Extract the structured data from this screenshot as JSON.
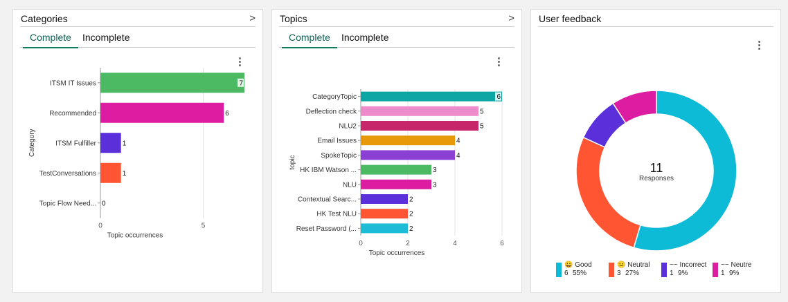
{
  "categories_card": {
    "title": "Categories",
    "nav_glyph": ">",
    "tabs": [
      "Complete",
      "Incomplete"
    ],
    "menu_glyph": "⋮",
    "chart_data": {
      "type": "bar",
      "orientation": "horizontal",
      "categories": [
        "ITSM IT Issues",
        "Recommended",
        "ITSM Fulfiller",
        "TestConversations",
        "Topic Flow Need..."
      ],
      "values": [
        7,
        6,
        1,
        1,
        0
      ],
      "colors": [
        "#4cba63",
        "#dd1da1",
        "#5b2fd9",
        "#ff5533",
        "#888888"
      ],
      "xlabel": "Topic occurrences",
      "ylabel": "Category",
      "xticks": [
        0,
        5
      ],
      "xlim": [
        0,
        7
      ],
      "grid": true
    }
  },
  "topics_card": {
    "title": "Topics",
    "nav_glyph": ">",
    "tabs": [
      "Complete",
      "Incomplete"
    ],
    "menu_glyph": "⋮",
    "chart_data": {
      "type": "bar",
      "orientation": "horizontal",
      "categories": [
        "CategoryTopic",
        "Deflection check",
        "NLU2",
        "Email Issues",
        "SpokeTopic",
        "HK IBM Watson ...",
        "NLU",
        "Contextual Searc...",
        "HK Test NLU",
        "Reset Password (..."
      ],
      "values": [
        6,
        5,
        5,
        4,
        4,
        3,
        3,
        2,
        2,
        2
      ],
      "colors": [
        "#0ea5a5",
        "#ee8ccb",
        "#c7276a",
        "#e7990a",
        "#8b3fd4",
        "#4cba63",
        "#dd1da1",
        "#5b2fd9",
        "#ff5533",
        "#1cbcd6"
      ],
      "xlabel": "Topic occurrences",
      "ylabel": "topic",
      "xticks": [
        0,
        2,
        4,
        6
      ],
      "xlim": [
        0,
        6
      ],
      "grid": true
    }
  },
  "feedback_card": {
    "title": "User feedback",
    "menu_glyph": "⋮",
    "center_value": "11",
    "center_label": "Responses",
    "chart_data": {
      "type": "pie",
      "donut": true,
      "categories": [
        "Good",
        "Neutral",
        "Incorrect",
        "Neutre"
      ],
      "values": [
        6,
        3,
        1,
        1
      ],
      "percent_labels": [
        "55%",
        "27%",
        "9%",
        "9%"
      ],
      "colors": [
        "#0ebbd6",
        "#ff5533",
        "#5b2fd9",
        "#dd1da1"
      ]
    },
    "legend": [
      {
        "prefix": "😀",
        "name": "Good",
        "count": "6",
        "pct": "55%"
      },
      {
        "prefix": "😐",
        "name": "Neutral",
        "count": "3",
        "pct": "27%"
      },
      {
        "prefix": "~~",
        "name": "Incorrect",
        "count": "1",
        "pct": "9%"
      },
      {
        "prefix": "~~",
        "name": "Neutre",
        "count": "1",
        "pct": "9%"
      }
    ]
  }
}
